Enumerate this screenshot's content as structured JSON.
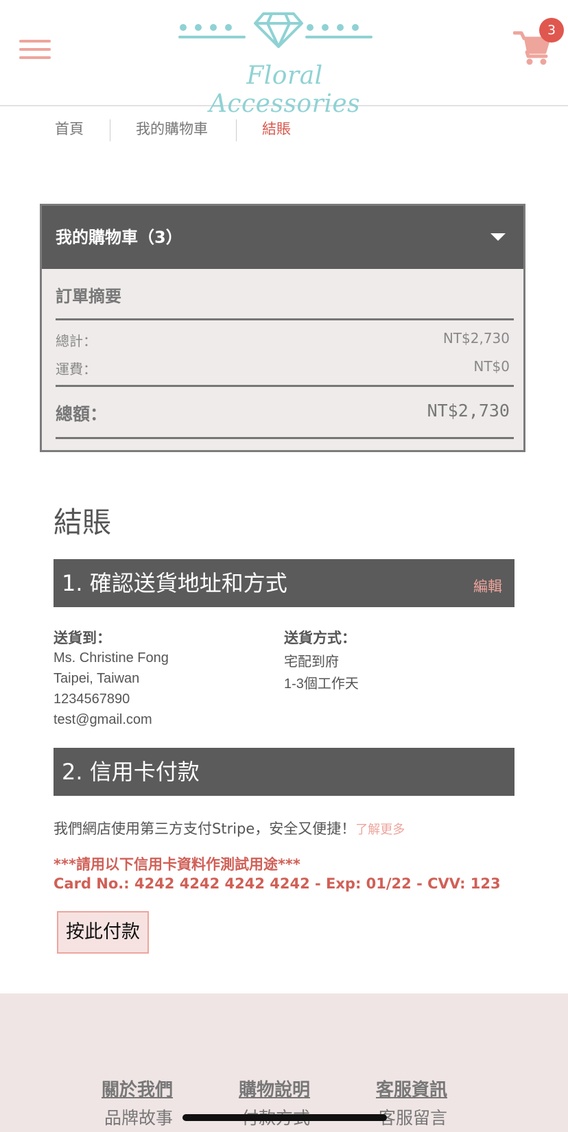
{
  "header": {
    "logo_text": "Floral Accessories",
    "cart_count": "3",
    "brand_color": "#8fd2d4",
    "accent_color": "#eea59c"
  },
  "breadcrumb": {
    "home": "首頁",
    "cart": "我的購物車",
    "checkout": "結賬"
  },
  "cart_box": {
    "title": "我的購物車（3）",
    "summary_title": "訂單摘要",
    "subtotal_label": "總計：",
    "subtotal_value": "NT$2,730",
    "shipping_label": "運費：",
    "shipping_value": "NT$0",
    "total_label": "總額：",
    "total_value": "NT$2,730"
  },
  "checkout": {
    "title": "結賬",
    "section1": {
      "title": "1. 確認送貨地址和方式",
      "edit": "編輯",
      "ship_to_heading": "送貨到：",
      "ship_to_lines": [
        "Ms. Christine Fong",
        "Taipei, Taiwan",
        "1234567890",
        "test@gmail.com"
      ],
      "method_heading": "送貨方式：",
      "method_lines": [
        "宅配到府",
        "1-3個工作天"
      ]
    },
    "section2": {
      "title": "2. 信用卡付款",
      "info": "我們網店使用第三方支付Stripe，安全又便捷！",
      "learn_more": "了解更多",
      "test_notice": "***請用以下信用卡資料作測試用途***",
      "test_card": "Card No.: 4242 4242 4242 4242 - Exp: 01/22 - CVV: 123",
      "pay_button": "按此付款"
    }
  },
  "footer": {
    "columns": [
      {
        "heading": "關於我們",
        "item": "品牌故事"
      },
      {
        "heading": "購物說明",
        "item": "付款方式"
      },
      {
        "heading": "客服資訊",
        "item": "客服留言"
      }
    ]
  }
}
